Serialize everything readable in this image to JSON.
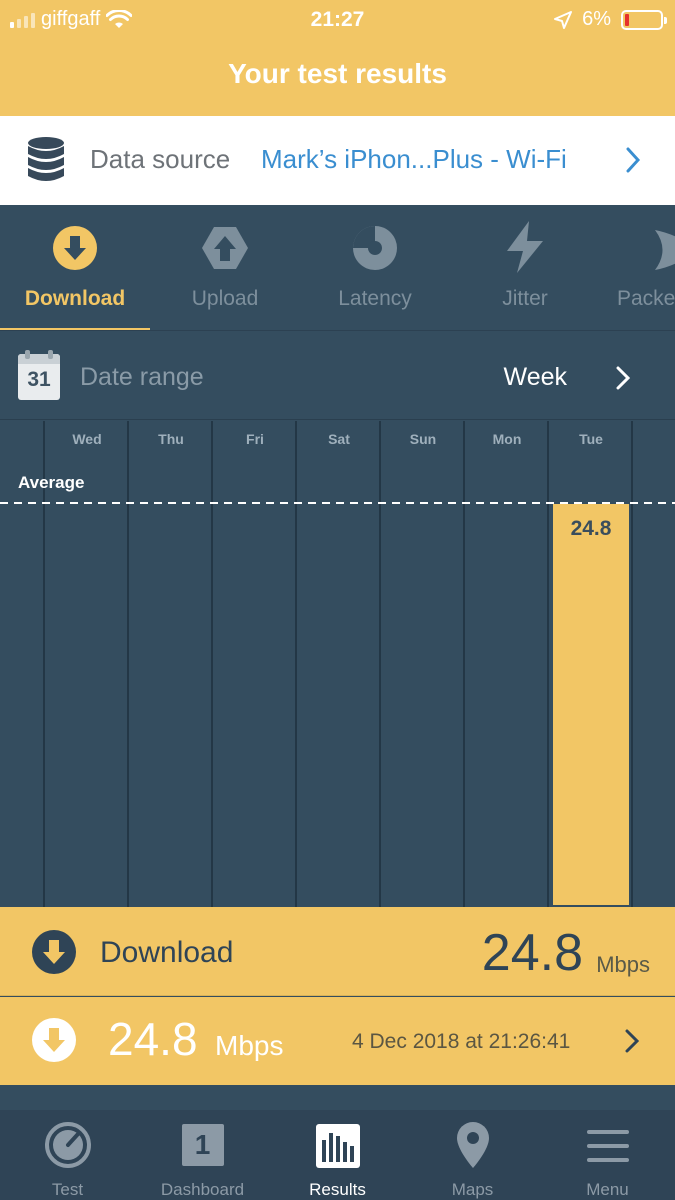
{
  "status_bar": {
    "carrier": "giffgaff",
    "time": "21:27",
    "battery": "6%"
  },
  "header": {
    "title": "Your test results"
  },
  "data_source": {
    "label": "Data source",
    "value": "Mark’s iPhon...Plus - Wi-Fi"
  },
  "metric_tabs": [
    {
      "label": "Download",
      "icon": "download-arrow-icon",
      "active": true
    },
    {
      "label": "Upload",
      "icon": "upload-arrow-icon",
      "active": false
    },
    {
      "label": "Latency",
      "icon": "latency-gauge-icon",
      "active": false
    },
    {
      "label": "Jitter",
      "icon": "lightning-icon",
      "active": false
    },
    {
      "label": "Packe",
      "icon": "packet-loss-icon",
      "active": false
    }
  ],
  "date_range": {
    "label": "Date range",
    "calendar_day": "31",
    "value": "Week"
  },
  "chart_data": {
    "type": "bar",
    "categories": [
      "Wed",
      "Thu",
      "Fri",
      "Sat",
      "Sun",
      "Mon",
      "Tue"
    ],
    "values": [
      null,
      null,
      null,
      null,
      null,
      null,
      24.8
    ],
    "data_labels": [
      "",
      "",
      "",
      "",
      "",
      "",
      "24.8"
    ],
    "average_label": "Average",
    "average_value": 24.8,
    "bar_color": "#f2c665",
    "ylim": [
      0,
      24.8
    ],
    "grid": true
  },
  "summary": {
    "label": "Download",
    "value": "24.8",
    "unit": "Mbps"
  },
  "latest_result": {
    "value": "24.8",
    "unit": "Mbps",
    "date": "4 Dec 2018 at 21:26:41"
  },
  "tab_bar": [
    {
      "label": "Test",
      "icon": "speedometer-icon",
      "active": false
    },
    {
      "label": "Dashboard",
      "icon": "dashboard-icon",
      "active": false,
      "badge": "1"
    },
    {
      "label": "Results",
      "icon": "results-bars-icon",
      "active": true
    },
    {
      "label": "Maps",
      "icon": "map-pin-icon",
      "active": false
    },
    {
      "label": "Menu",
      "icon": "hamburger-menu-icon",
      "active": false
    }
  ],
  "colors": {
    "accent": "#f2c665",
    "panel": "#344d5f",
    "link": "#3a8ed0"
  }
}
